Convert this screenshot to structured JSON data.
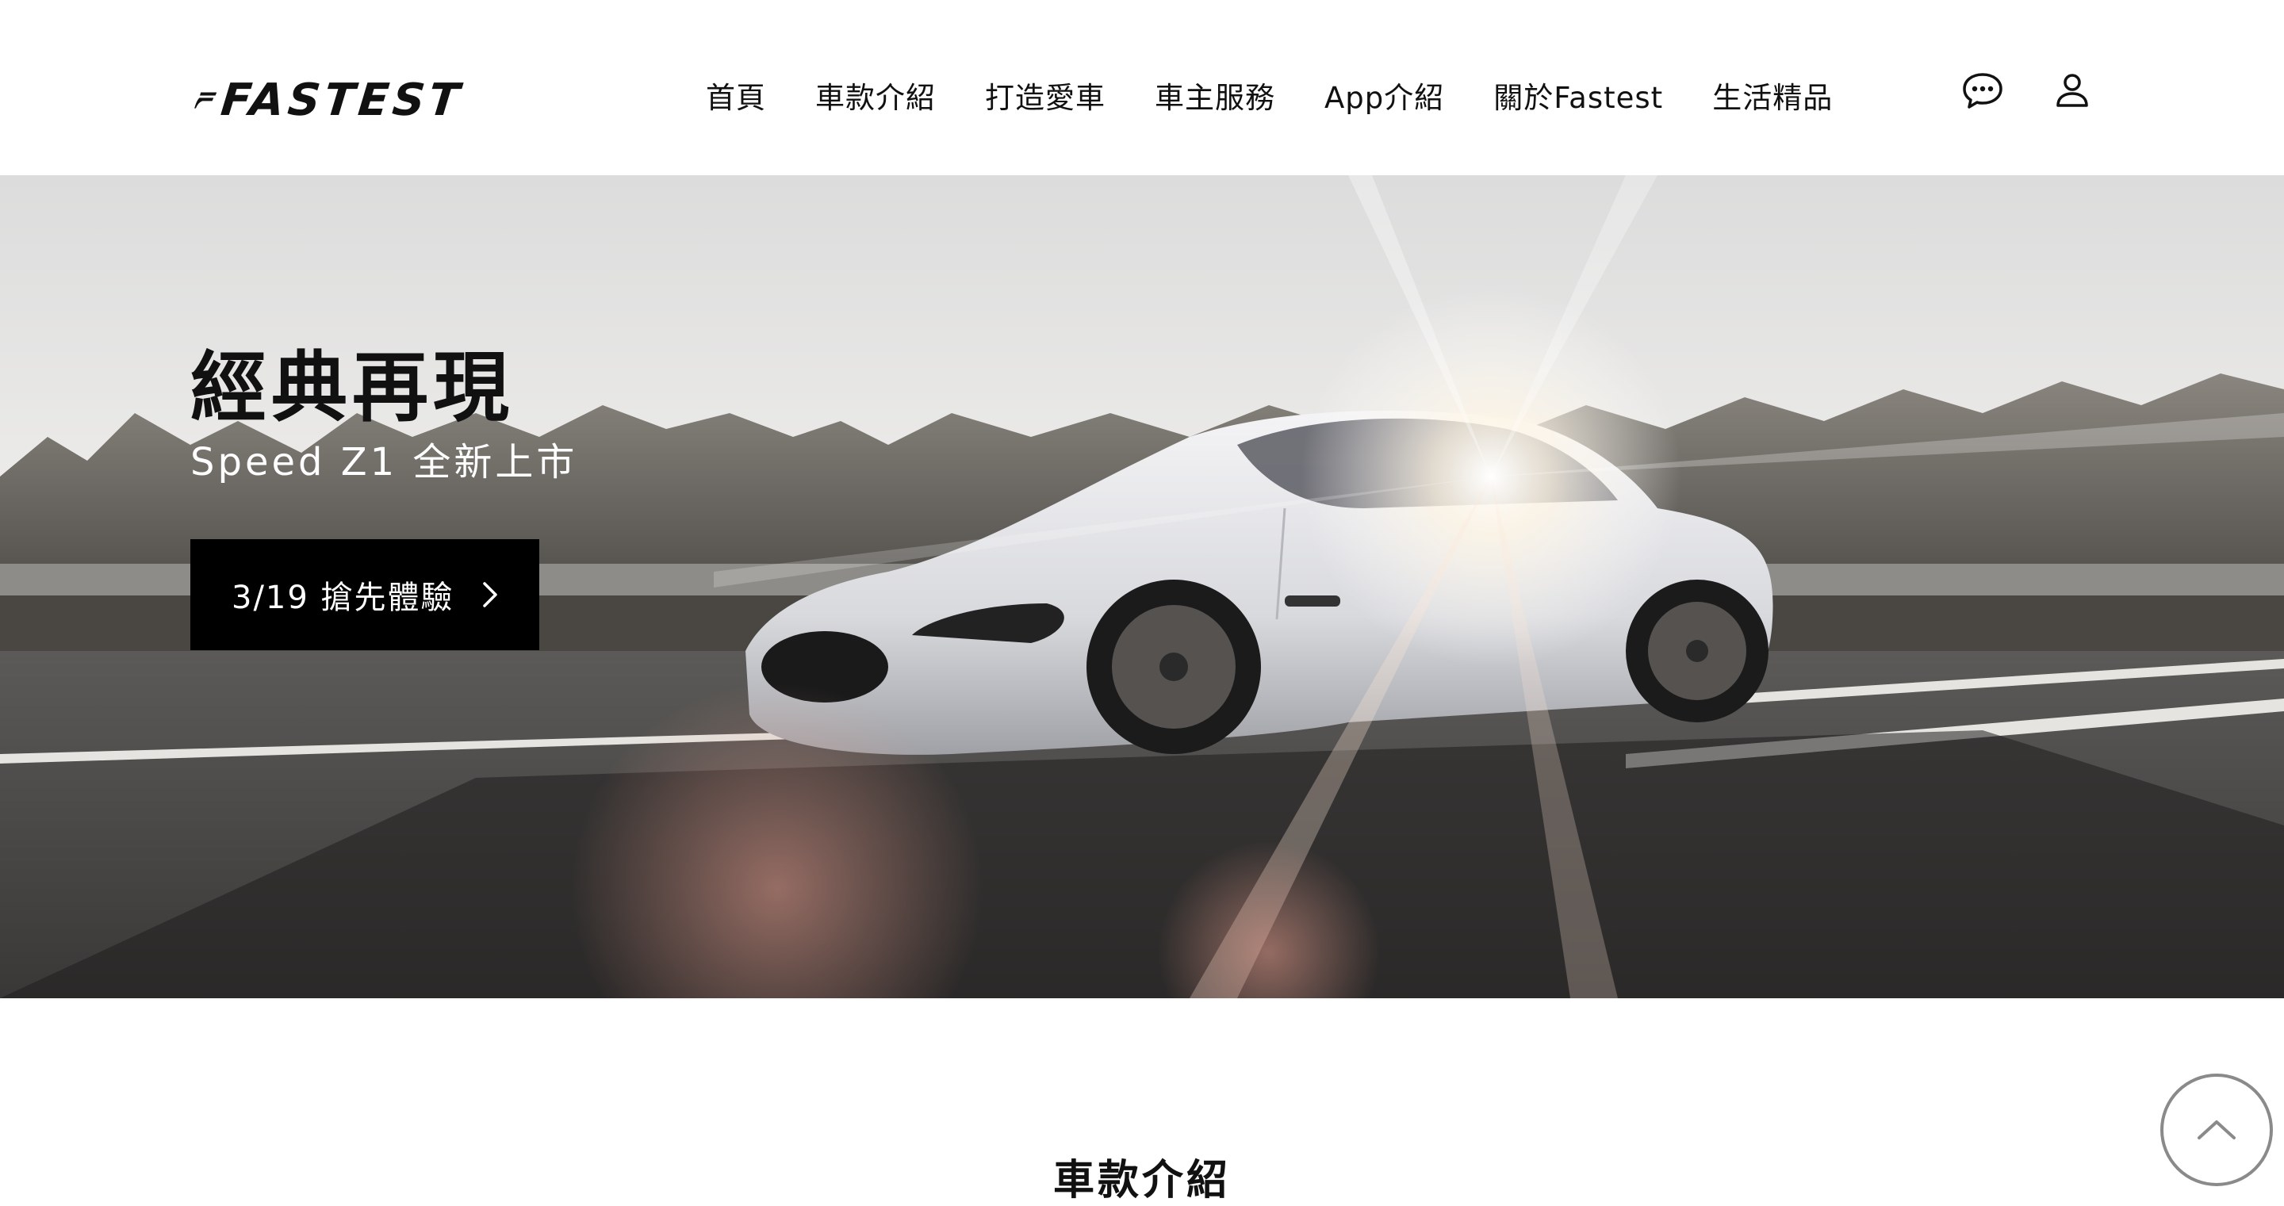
{
  "header": {
    "brand": "FASTEST",
    "nav": [
      "首頁",
      "車款介紹",
      "打造愛車",
      "車主服務",
      "App介紹",
      "關於Fastest",
      "生活精品"
    ],
    "icons": {
      "chat": "chat-bubble-icon",
      "user": "user-icon"
    }
  },
  "hero": {
    "title": "經典再現",
    "subtitle": "Speed Z1 全新上市",
    "cta_label": "3/19 搶先體驗"
  },
  "section": {
    "title": "車款介紹"
  },
  "colors": {
    "text": "#111111",
    "cta_bg": "#000000",
    "page_bg": "#ffffff"
  }
}
